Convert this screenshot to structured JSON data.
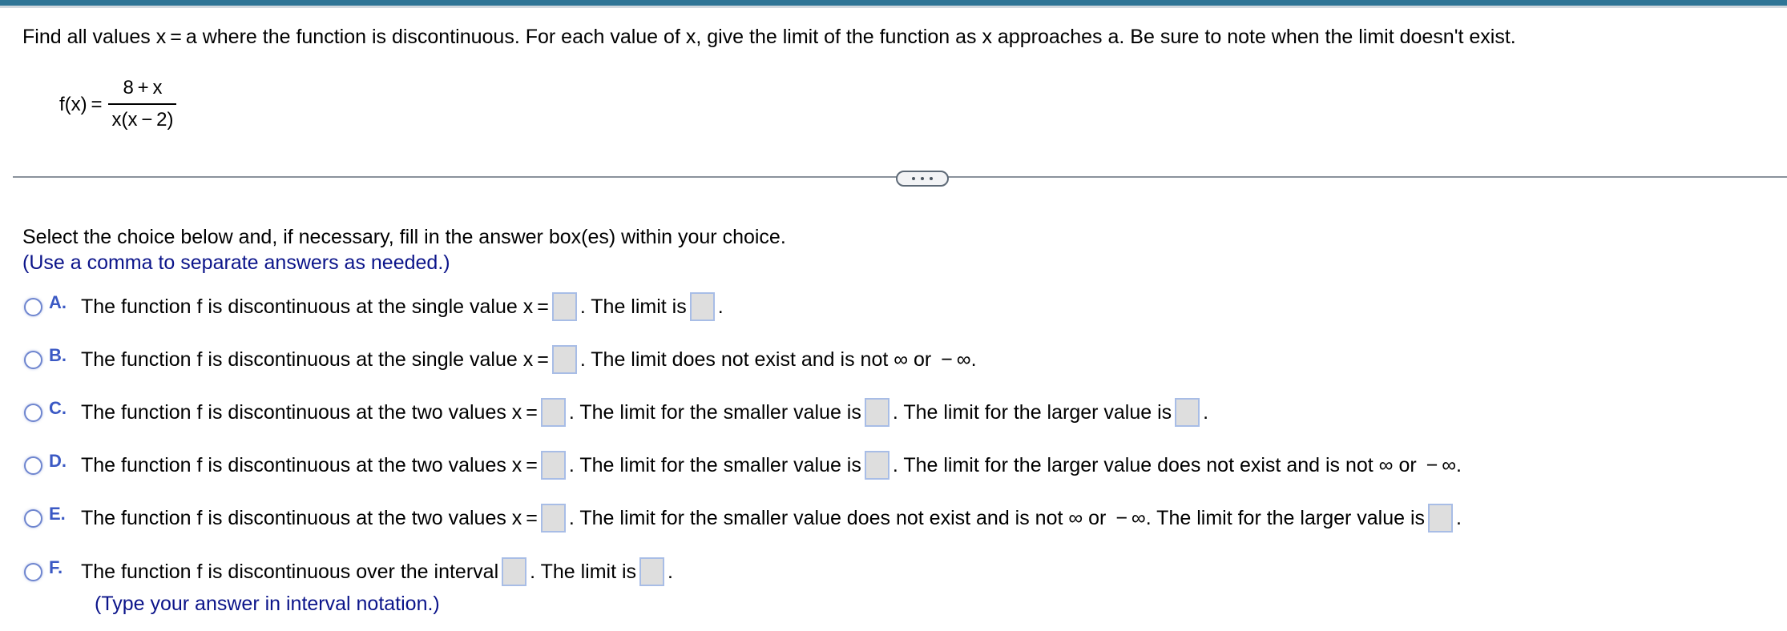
{
  "header": {
    "accent_color": "#2f7596"
  },
  "question": {
    "prompt": "Find all values x = a where the function is discontinuous. For each value of x, give the limit of the function as x approaches a. Be sure to note when the limit doesn't exist.",
    "function_label": "f(x) =",
    "numerator": "8 + x",
    "denominator": "x(x − 2)"
  },
  "divider": {
    "more_icon": "ellipsis-icon"
  },
  "instructions": {
    "main": "Select the choice below and, if necessary, fill in the answer box(es) within your choice.",
    "note": "(Use a comma to separate answers as needed.)"
  },
  "choices": [
    {
      "letter": "A.",
      "parts": [
        "The function f is discontinuous at the single value x =",
        ". The limit is",
        "."
      ]
    },
    {
      "letter": "B.",
      "parts": [
        "The function f is discontinuous at the single value x =",
        ". The limit does not exist and is not ∞ or  − ∞."
      ]
    },
    {
      "letter": "C.",
      "parts": [
        "The function f is discontinuous at the two values x =",
        ". The limit for the smaller value is",
        ". The limit for the larger value is",
        "."
      ]
    },
    {
      "letter": "D.",
      "parts": [
        "The function f is discontinuous at the two values x =",
        ". The limit for the smaller value is",
        ". The limit for the larger value does not exist and is not ∞ or  − ∞."
      ]
    },
    {
      "letter": "E.",
      "parts": [
        "The function f is discontinuous at the two values x =",
        ". The limit for the smaller value does not exist and is not ∞ or  − ∞. The limit for the larger value is",
        "."
      ]
    },
    {
      "letter": "F.",
      "parts": [
        "The function f is discontinuous over the interval",
        ". The limit is",
        "."
      ],
      "note": "(Type your answer in interval notation.)"
    }
  ],
  "answer_boxes": {
    "value": ""
  }
}
